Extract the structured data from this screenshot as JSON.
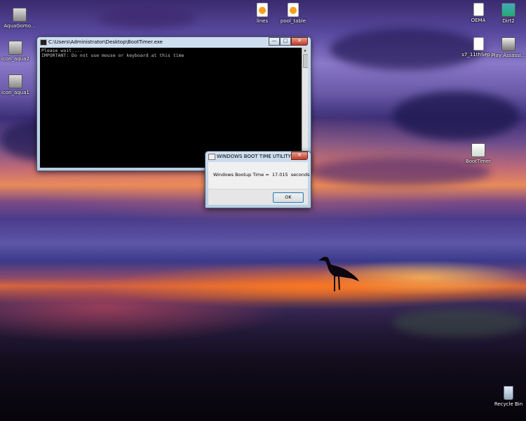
{
  "desktop_icons": [
    {
      "label": "AquaGomo...",
      "icon": "monitor-icon"
    },
    {
      "label": "icon_aqua2",
      "icon": "monitor-icon"
    },
    {
      "label": "icon_aqua1",
      "icon": "monitor-icon"
    },
    {
      "label": "lines",
      "icon": "vlc-file-icon"
    },
    {
      "label": "pool_table",
      "icon": "vlc-file-icon"
    },
    {
      "label": "OEMA",
      "icon": "document-icon"
    },
    {
      "label": "Dirt2",
      "icon": "game-icon"
    },
    {
      "label": "s7_11thSep...",
      "icon": "document-icon"
    },
    {
      "label": "Play Assassi...",
      "icon": "game-icon"
    },
    {
      "label": "BootTimer",
      "icon": "app-icon"
    },
    {
      "label": "Recycle Bin",
      "icon": "recycle-bin-icon"
    }
  ],
  "console": {
    "title": "C:\\Users\\Administrator\\Desktop\\BootTimer.exe",
    "lines": [
      "Please wait....",
      "IMPORTANT: Do not use mouse or keyboard at this time"
    ],
    "minimize": "—",
    "maximize": "□",
    "close": "✕"
  },
  "dialog": {
    "title": "WINDOWS BOOT TIME UTILITY",
    "message": "Windows Bootup Time =  17.015  seconds",
    "ok_label": "OK",
    "close": "✕"
  },
  "colors": {
    "console_bg": "#000000",
    "window_frame": "#b7cde4",
    "close_red": "#c0392b"
  }
}
